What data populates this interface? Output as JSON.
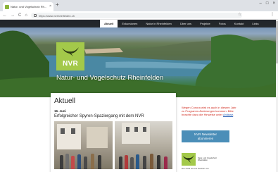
{
  "browser": {
    "tab_title": "Natur- und Vogelschutz Rh...",
    "tab_close": "×",
    "new_tab": "+",
    "back": "←",
    "forward": "→",
    "reload": "C",
    "home": "⌂",
    "url": "https://www.nvrheinfelden.ch",
    "bookmark": "☆",
    "menu": "⋮",
    "minimize": "–",
    "maximize": "□",
    "close": "×"
  },
  "nav": {
    "items": [
      {
        "label": "Aktuell",
        "active": true
      },
      {
        "label": "Exkursionen"
      },
      {
        "label": "Natur in Rheinfelden"
      },
      {
        "label": "Über uns"
      },
      {
        "label": "Projekte"
      },
      {
        "label": "Fotos"
      },
      {
        "label": "Kontakt"
      },
      {
        "label": "Links"
      }
    ]
  },
  "hero": {
    "logo_text": "NVR",
    "title": "Natur- und Vogelschutz Rheinfelden"
  },
  "main": {
    "section_title": "Aktuell",
    "post_date": "16. Juni",
    "post_title": "Erfolgreicher Spyren-Spaziergang mit dem NVR"
  },
  "sidebar": {
    "notice_text": "Wegen Corona wird es auch in diesem Jahr zu Programm-Änderungen kommen. Bitte beachte dazu die Hinweise unter",
    "notice_link": "Anlässe",
    "notice_end": ".",
    "newsletter_line1": "NVR Newsletter",
    "newsletter_line2": "abonnieren",
    "logo_caption": "Natur- und Vogelschutz Rheinfelden",
    "caption": "Der NVR ist eine Sektion von"
  },
  "colors": {
    "brand_green": "#a3c94a",
    "notice_red": "#d02b1f",
    "button_blue": "#4b8eb8"
  }
}
